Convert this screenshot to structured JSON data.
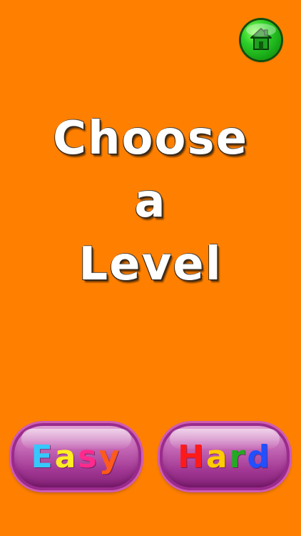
{
  "title": {
    "line1": "Choose",
    "line2": "a",
    "line3": "Level"
  },
  "home_button": {
    "icon": "house-icon"
  },
  "levels": [
    {
      "label": "Easy",
      "letter_colors": [
        "#35c8ff",
        "#ffee22",
        "#ff2a8c",
        "#ff5a1a"
      ]
    },
    {
      "label": "Hard",
      "letter_colors": [
        "#ff1a1a",
        "#ffcc00",
        "#22aa22",
        "#2050ff"
      ]
    }
  ],
  "colors": {
    "background": "#ff8000",
    "home_button": "#22b320",
    "level_button": "#b04aa2"
  }
}
